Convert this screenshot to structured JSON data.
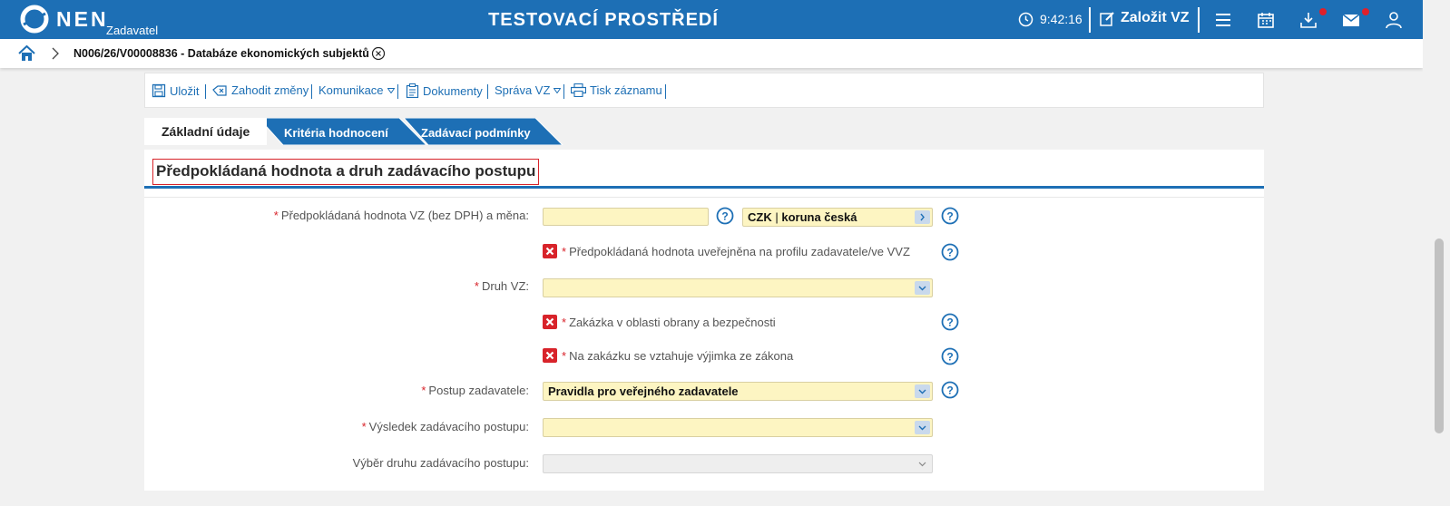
{
  "header": {
    "logo_text": "NEN",
    "logo_sub": "Zadavatel",
    "environment_title": "TESTOVACÍ PROSTŘEDÍ",
    "time": "9:42:16",
    "new_vz_label": "Založit VZ",
    "brand_color": "#1d6fb5"
  },
  "breadcrumb": {
    "current": "N006/26/V00008836 - Databáze ekonomických subjektů"
  },
  "toolbar": {
    "save": "Uložit",
    "discard": "Zahodit změny",
    "communication": "Komunikace",
    "documents": "Dokumenty",
    "manage_vz": "Správa VZ",
    "print": "Tisk záznamu"
  },
  "tabs": [
    {
      "label": "Základní údaje",
      "active": true
    },
    {
      "label": "Kritéria hodnocení",
      "active": false
    },
    {
      "label": "Zadávací podmínky",
      "active": false
    }
  ],
  "section": {
    "title": "Předpokládaná hodnota a druh zadávacího postupu"
  },
  "form": {
    "estimated_value": {
      "label": "Předpokládaná hodnota VZ (bez DPH) a měna:",
      "value": "",
      "currency_code": "CZK",
      "currency_name": "koruna česká"
    },
    "value_published": {
      "label": "Předpokládaná hodnota uveřejněna na profilu zadavatele/ve VVZ",
      "checked": false
    },
    "kind_vz": {
      "label": "Druh VZ:",
      "value": ""
    },
    "defense": {
      "label": "Zakázka v oblasti obrany a bezpečnosti",
      "checked": false
    },
    "exemption": {
      "label": "Na zakázku se vztahuje výjimka ze zákona",
      "checked": false
    },
    "procedure": {
      "label": "Postup zadavatele:",
      "value": "Pravidla pro veřejného zadavatele"
    },
    "result": {
      "label": "Výsledek zadávacího postupu:",
      "value": ""
    },
    "procedure_kind": {
      "label": "Výběr druhu zadávacího postupu:",
      "value": ""
    }
  }
}
